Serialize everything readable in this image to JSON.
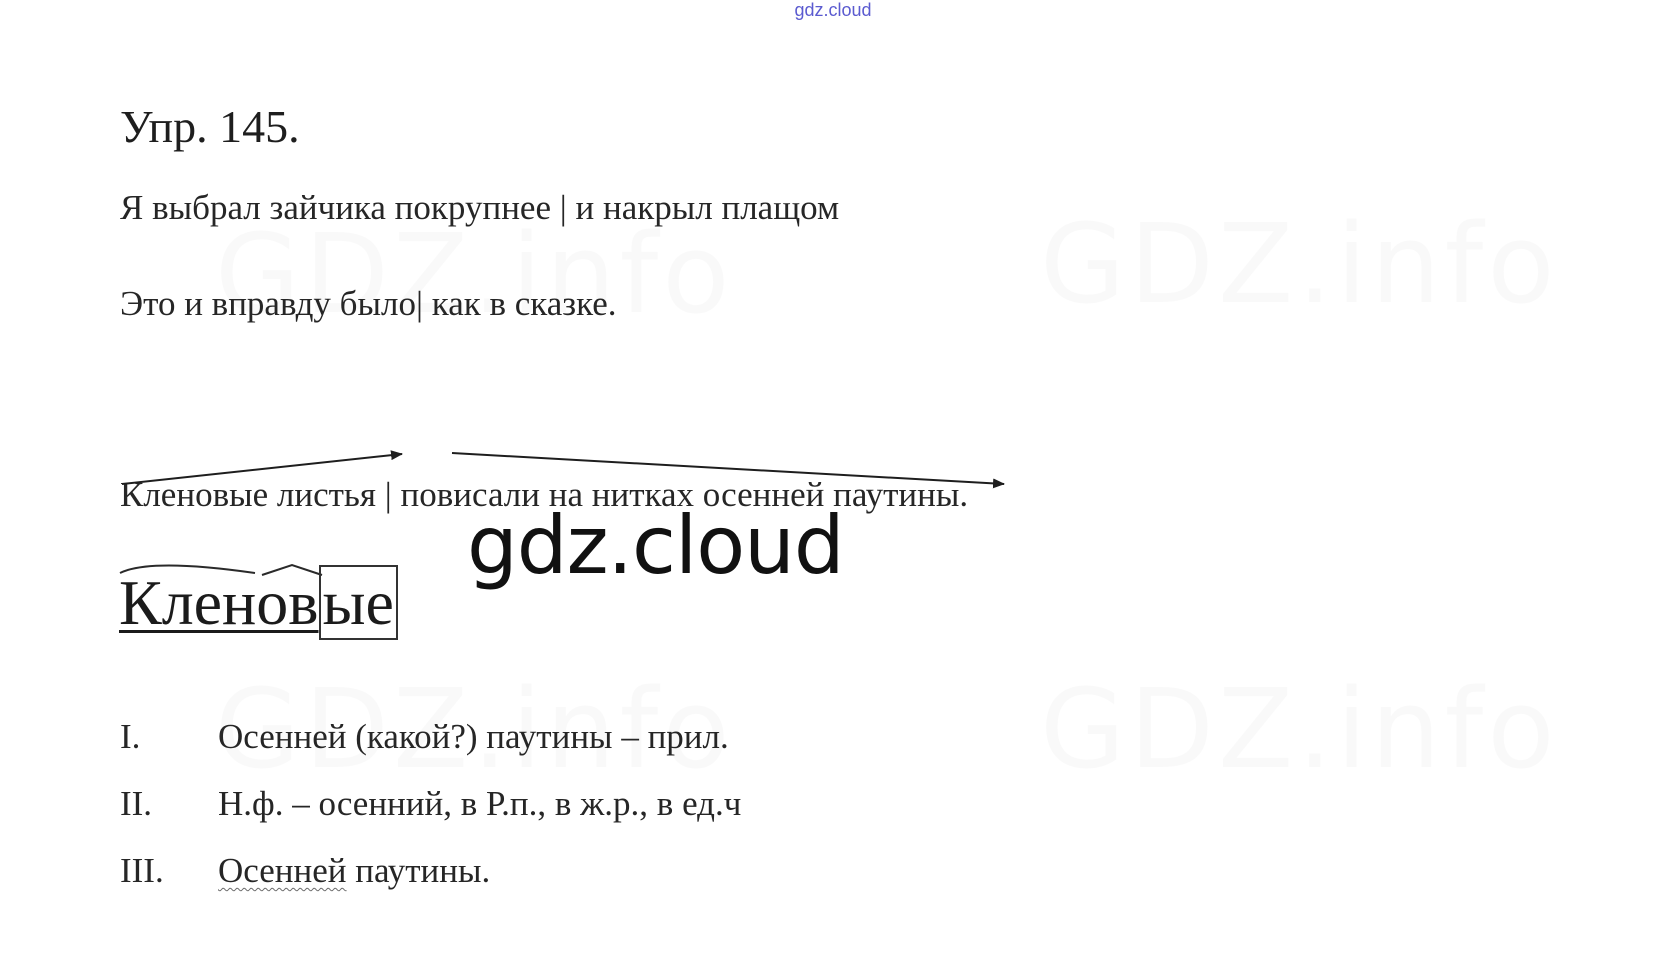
{
  "watermark_top": "gdz.cloud",
  "watermark_center": "gdz.cloud",
  "watermark_faint": "GDZ.info",
  "title": "Упр. 145.",
  "sentences": [
    "Я выбрал зайчика покрупнее | и накрыл плащом",
    "Это и вправду было| как в сказке.",
    "Кленовые листья | повисали на нитках осенней паутины."
  ],
  "word_analysis": {
    "stem": "Кленов",
    "ending": "ые"
  },
  "list": [
    {
      "num": "I.",
      "text": "Осенней (какой?) паутины – прил."
    },
    {
      "num": "II.",
      "text": "Н.ф. – осенний, в Р.п., в ж.р., в ед.ч"
    },
    {
      "num": "III.",
      "underlined": "Осенней",
      "rest": " паутины."
    }
  ],
  "colors": {
    "watermark_top": "#5b5bd0",
    "text": "#262626"
  }
}
